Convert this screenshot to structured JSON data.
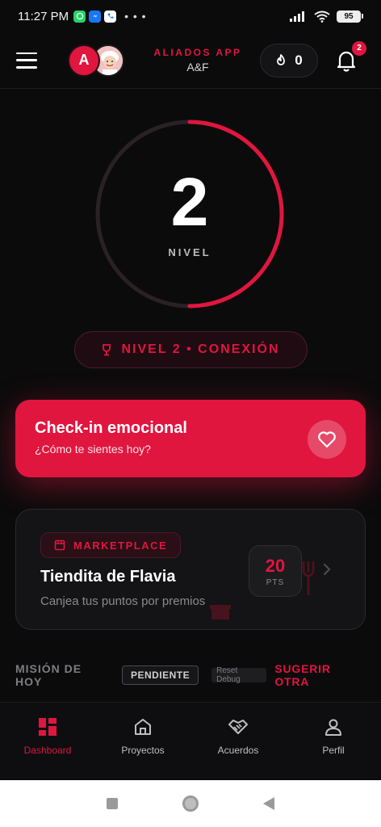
{
  "status_bar": {
    "time": "11:27 PM",
    "dots": "• • •",
    "battery": "95"
  },
  "header": {
    "avatar_initial": "A",
    "brand_title": "ALIADOS APP",
    "brand_subtitle": "A&F",
    "streak_count": "0",
    "notifications_count": "2"
  },
  "level": {
    "number": "2",
    "label": "NIVEL",
    "progress": 0.5,
    "pill_text": "NIVEL 2 • CONEXIÓN"
  },
  "checkin": {
    "title": "Check-in emocional",
    "subtitle": "¿Cómo te sientes hoy?"
  },
  "marketplace": {
    "chip_label": "MARKETPLACE",
    "title": "Tiendita de Flavia",
    "subtitle": "Canjea tus puntos por premios",
    "points_value": "20",
    "points_unit": "PTS"
  },
  "mission": {
    "label": "MISIÓN DE HOY",
    "status": "PENDIENTE",
    "reset_label": "Reset Debug",
    "suggest_label": "SUGERIR OTRA"
  },
  "bottom_nav": {
    "items": [
      {
        "label": "Dashboard",
        "icon": "dashboard-icon",
        "active": true
      },
      {
        "label": "Proyectos",
        "icon": "home-icon",
        "active": false
      },
      {
        "label": "Acuerdos",
        "icon": "handshake-icon",
        "active": false
      },
      {
        "label": "Perfil",
        "icon": "user-icon",
        "active": false
      }
    ]
  },
  "colors": {
    "accent": "#e0163f",
    "background": "#0b0b0c",
    "card": "#141315"
  }
}
